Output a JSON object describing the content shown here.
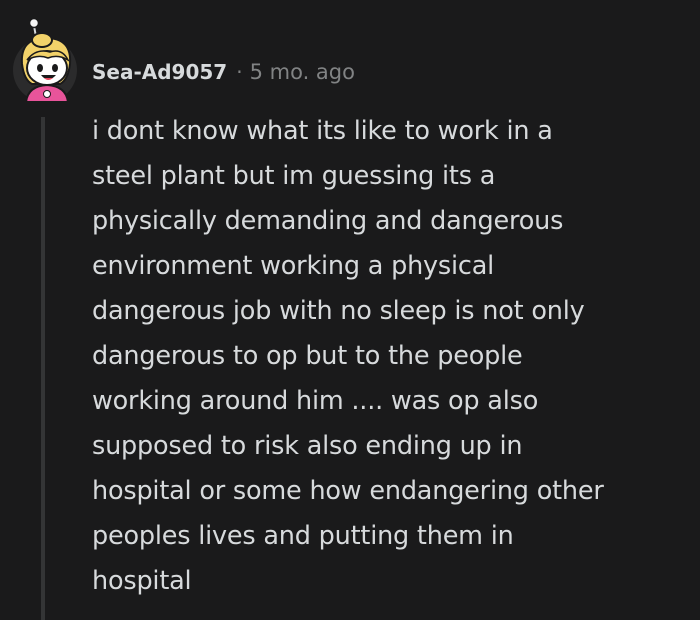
{
  "comment": {
    "author": "Sea-Ad9057",
    "separator": "·",
    "time": "5 mo. ago",
    "avatar_icon": "snoo-avatar-blonde-pink-hoodie-icon",
    "body_lines": [
      "i dont know what its like to work in a",
      "steel plant but im guessing its a",
      "physically demanding and dangerous",
      "environment working a physical",
      "dangerous job with no sleep is not only",
      "dangerous to op but to the people",
      "working around him .... was op also",
      "supposed to risk also ending up in",
      "hospital or some how endangering other",
      "peoples lives and putting them in",
      "hospital"
    ]
  },
  "colors": {
    "background": "#1a1a1b",
    "text": "#d7dadc",
    "meta": "#818384",
    "thread_line": "#343536",
    "hoodie": "#e8549a",
    "hair": "#f2d26a"
  }
}
